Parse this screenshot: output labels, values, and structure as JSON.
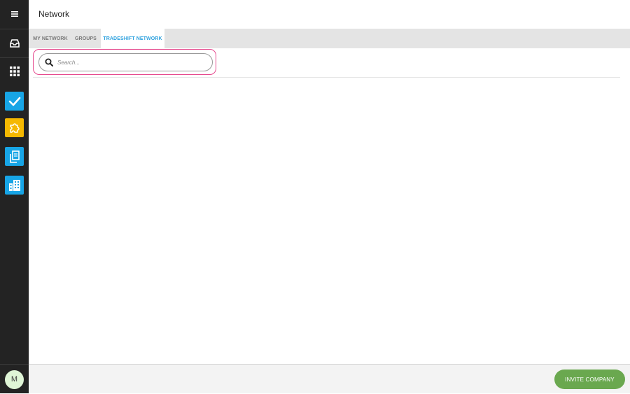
{
  "header": {
    "title": "Network"
  },
  "tabs": [
    {
      "label": "MY NETWORK"
    },
    {
      "label": "GROUPS"
    },
    {
      "label": "TRADESHIFT NETWORK",
      "active": true
    }
  ],
  "search": {
    "placeholder": "Search...",
    "value": ""
  },
  "sidebar": {
    "items": [
      {
        "icon": "menu-icon"
      },
      {
        "icon": "inbox-icon"
      },
      {
        "icon": "apps-grid-icon"
      },
      {
        "icon": "tasks-check-icon",
        "color": "#17a5e6"
      },
      {
        "icon": "puzzle-icon",
        "color": "#f5b800"
      },
      {
        "icon": "documents-icon",
        "color": "#17a5e6"
      },
      {
        "icon": "building-icon",
        "color": "#17a5e6"
      }
    ],
    "avatar": {
      "initial": "M",
      "color": "#dff5d6"
    }
  },
  "footer": {
    "invite_label": "INVITE COMPANY",
    "accent": "#6aa84f"
  },
  "colors": {
    "sidebar_bg": "#232323",
    "active_tab": "#2da1de",
    "highlight": "#e64a8e"
  }
}
